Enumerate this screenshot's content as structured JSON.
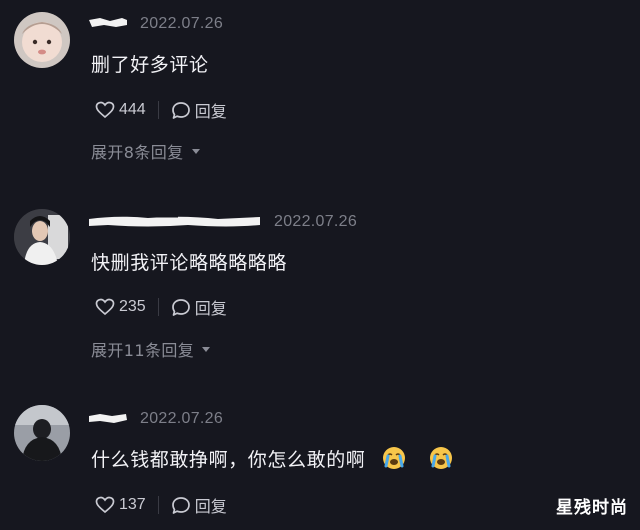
{
  "comments": [
    {
      "date": "2022.07.26",
      "text": "删了好多评论",
      "likes": "444",
      "reply_label": "回复",
      "expand_label": "展开8条回复"
    },
    {
      "date": "2022.07.26",
      "text": "快删我评论略略略略略",
      "likes": "235",
      "reply_label": "回复",
      "expand_label": "展开11条回复"
    },
    {
      "date": "2022.07.26",
      "text": "什么钱都敢挣啊，你怎么敢的啊",
      "likes": "137",
      "reply_label": "回复",
      "emoji": [
        "crying-face",
        "crying-face"
      ]
    }
  ],
  "watermark": "星残时尚"
}
